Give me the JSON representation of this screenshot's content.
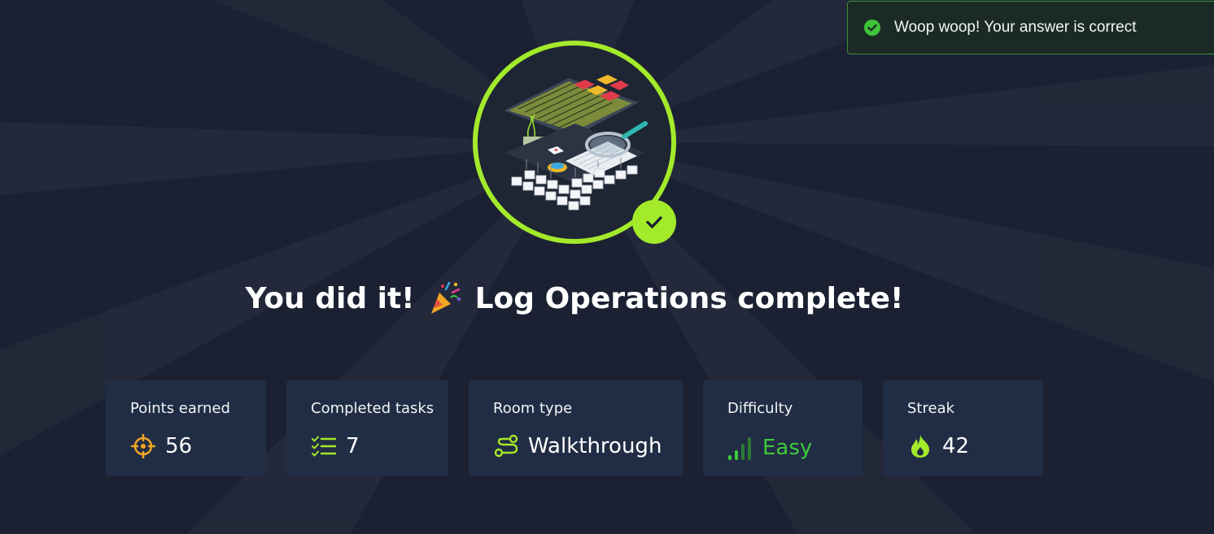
{
  "toast": {
    "message": "Woop woop! Your answer is correct",
    "icon": "check-circle-icon",
    "color": "#3f8f3b"
  },
  "badge": {
    "art": "log-operations-room-illustration",
    "check_icon": "checkmark-icon",
    "accent": "#a3ea2a"
  },
  "headline": {
    "prefix": "You did it!",
    "emoji_icon": "party-popper-icon",
    "suffix": "Log Operations complete!"
  },
  "stats": [
    {
      "label": "Points earned",
      "value": "56",
      "icon": "target-icon"
    },
    {
      "label": "Completed tasks",
      "value": "7",
      "icon": "checklist-icon"
    },
    {
      "label": "Room type",
      "value": "Walkthrough",
      "icon": "route-icon"
    },
    {
      "label": "Difficulty",
      "value": "Easy",
      "icon": "signal-bars-icon",
      "color": "#3ec93a"
    },
    {
      "label": "Streak",
      "value": "42",
      "icon": "flame-icon"
    }
  ]
}
